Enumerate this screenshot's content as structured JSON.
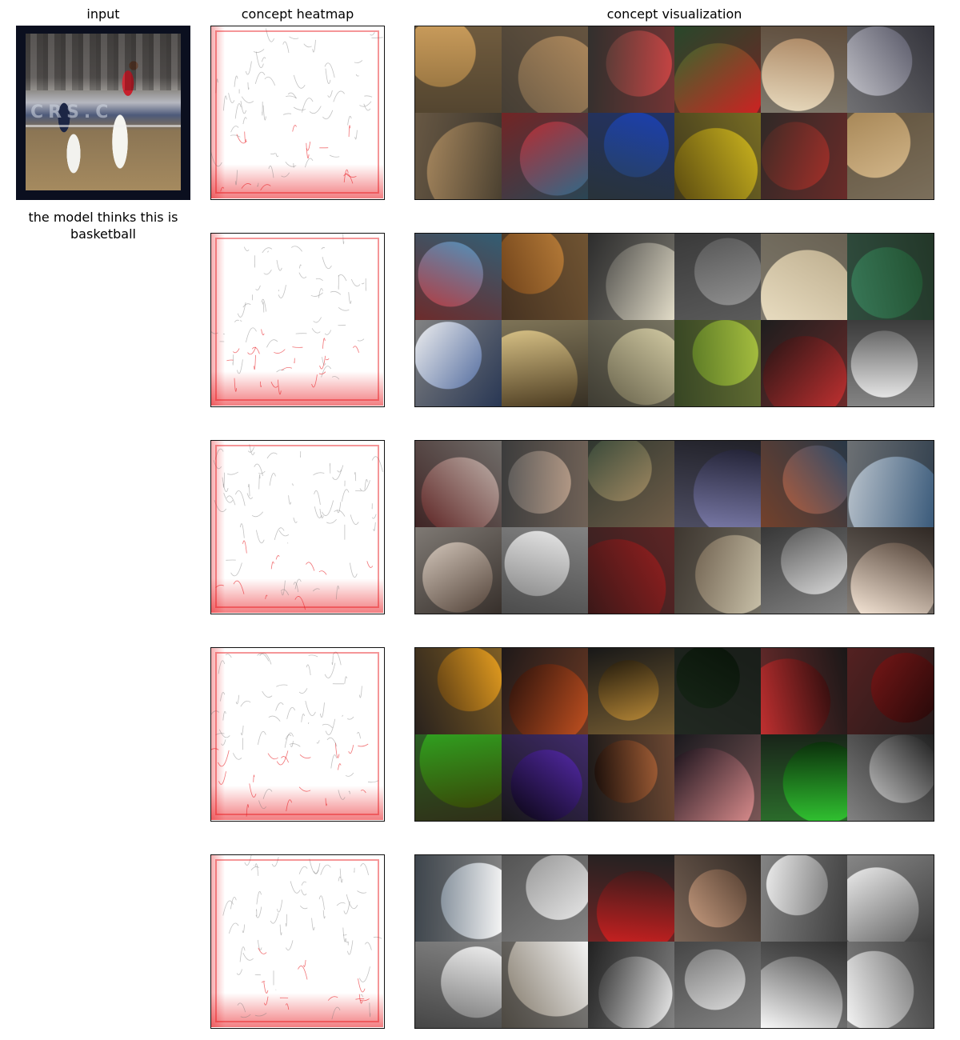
{
  "headers": {
    "input": "input",
    "heatmap": "concept heatmap",
    "visualization": "concept visualization"
  },
  "caption": "the model thinks this is basketball",
  "input_image_text": "CRS.C",
  "rows": [
    {
      "heatmap_color": "#e8161b",
      "tiles": [
        [
          "#8a6a3a",
          "#c79a5a"
        ],
        [
          "#6a5a45",
          "#b08a5d"
        ],
        [
          "#3f3a34",
          "#c44"
        ],
        [
          "#2a6e2f",
          "#c22"
        ],
        [
          "#a27a55",
          "#e9dcc0"
        ],
        [
          "#445",
          "#c9c9cf"
        ],
        [
          "#4a4030",
          "#b59265"
        ],
        [
          "#2d6a8a",
          "#c22"
        ],
        [
          "#2a4050",
          "#1b3fb0"
        ],
        [
          "#5a4a10",
          "#d8c020"
        ],
        [
          "#3a2a25",
          "#b8302a"
        ],
        [
          "#a88858",
          "#e0c59a"
        ]
      ]
    },
    {
      "heatmap_color": "#e8161b",
      "tiles": [
        [
          "#c03030",
          "#40a0d0"
        ],
        [
          "#6a3e18",
          "#c88a40"
        ],
        [
          "#333",
          "#e2dcc8"
        ],
        [
          "#505050",
          "#9a9a9a"
        ],
        [
          "#b8a888",
          "#e8dcc0"
        ],
        [
          "#1e4a2a",
          "#3a7a5a"
        ],
        [
          "#2a4a8a",
          "#f0f0f0"
        ],
        [
          "#4a3a20",
          "#e6cf90"
        ],
        [
          "#5a5540",
          "#d8d0a8"
        ],
        [
          "#4a6a20",
          "#a8c040"
        ],
        [
          "#111",
          "#c03030"
        ],
        [
          "#555",
          "#f4f4f4"
        ]
      ]
    },
    {
      "heatmap_color": "#e8161b",
      "tiles": [
        [
          "#5a2020",
          "#c8c0b8"
        ],
        [
          "#555",
          "#c8a890"
        ],
        [
          "#3a4a3a",
          "#c8a070"
        ],
        [
          "#1a1a2a",
          "#7a7aa8"
        ],
        [
          "#2a4a6a",
          "#d06030"
        ],
        [
          "#3a5a7a",
          "#c0c8d0"
        ],
        [
          "#4a3a30",
          "#e8dcd0"
        ],
        [
          "#777",
          "#f0f0f0"
        ],
        [
          "#3a1818",
          "#a02020"
        ],
        [
          "#5a4a3a",
          "#c8c0a8"
        ],
        [
          "#4a4a4a",
          "#f2f2f2"
        ],
        [
          "#3a2a20",
          "#f8e8d8"
        ]
      ]
    },
    {
      "heatmap_color": "#e8161b",
      "tiles": [
        [
          "#2a1a10",
          "#e8a020"
        ],
        [
          "#140808",
          "#c05020"
        ],
        [
          "#050505",
          "#d8a040"
        ],
        [
          "#081208",
          "#1a2a1a"
        ],
        [
          "#0a0505",
          "#c03030"
        ],
        [
          "#200808",
          "#8a1a1a"
        ],
        [
          "#3a3a05",
          "#30a020"
        ],
        [
          "#050308",
          "#6030c0"
        ],
        [
          "#0a0505",
          "#c07040"
        ],
        [
          "#0a0812",
          "#e09090"
        ],
        [
          "#082008",
          "#30c030"
        ],
        [
          "#1a1a1a",
          "#f0f0f0"
        ]
      ]
    },
    {
      "heatmap_color": "#e8161b",
      "tiles": [
        [
          "#5a6a7a",
          "#f4f4f4"
        ],
        [
          "#8a8a8a",
          "#f4f4f4"
        ],
        [
          "#1a1a1a",
          "#c82020"
        ],
        [
          "#3a2a20",
          "#e0b090"
        ],
        [
          "#5a5a5a",
          "#f4f4f4"
        ],
        [
          "#5a5a5a",
          "#f8f8f8"
        ],
        [
          "#6a6a6a",
          "#f4f4f4"
        ],
        [
          "#7a7060",
          "#f4f4f4"
        ],
        [
          "#1a1a1a",
          "#f0f0f0"
        ],
        [
          "#6a6a6a",
          "#f4f4f4"
        ],
        [
          "#3a3a3a",
          "#f8f8f8"
        ],
        [
          "#5a5a5a",
          "#f4f4f4"
        ]
      ]
    }
  ]
}
